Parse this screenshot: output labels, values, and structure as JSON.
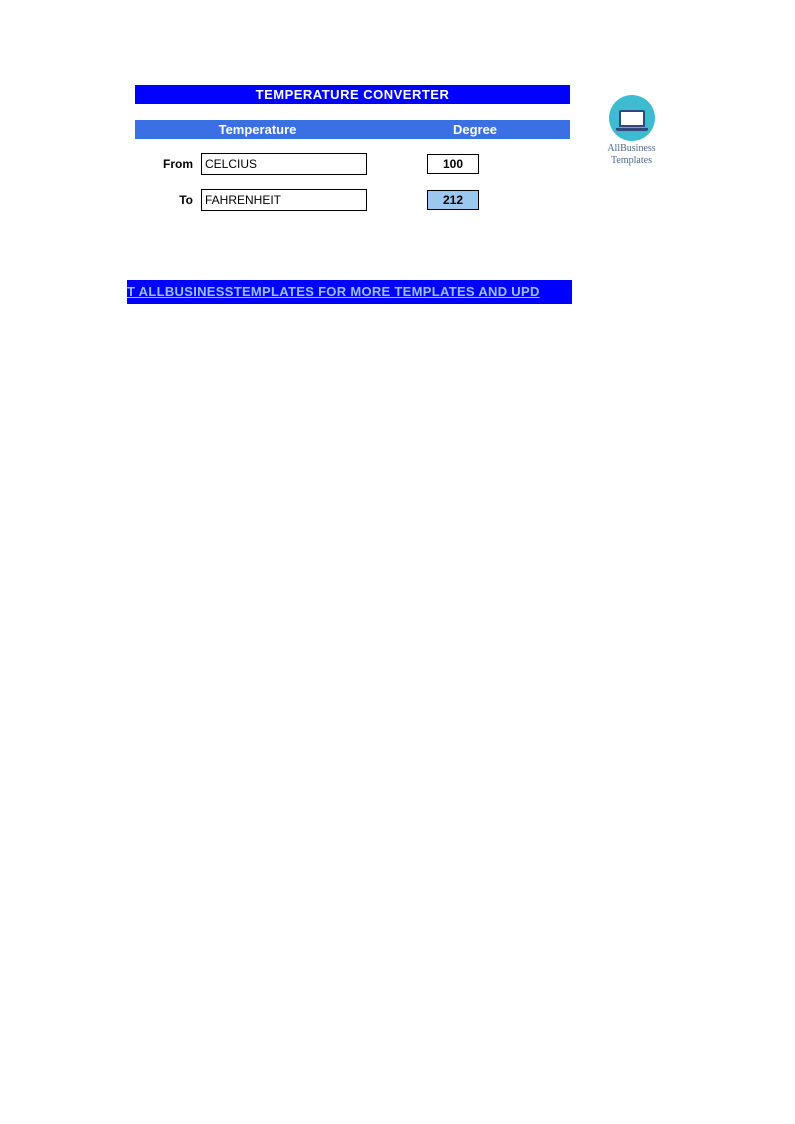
{
  "title": "TEMPERATURE CONVERTER",
  "headers": {
    "temperature": "Temperature",
    "degree": "Degree"
  },
  "rows": {
    "from": {
      "label": "From",
      "unit": "CELCIUS",
      "value": "100"
    },
    "to": {
      "label": "To",
      "unit": "FAHRENHEIT",
      "value": "212"
    }
  },
  "footer_link": "T ALLBUSINESSTEMPLATES FOR MORE TEMPLATES AND UPD",
  "logo": {
    "line1": "AllBusiness",
    "line2": "Templates"
  }
}
